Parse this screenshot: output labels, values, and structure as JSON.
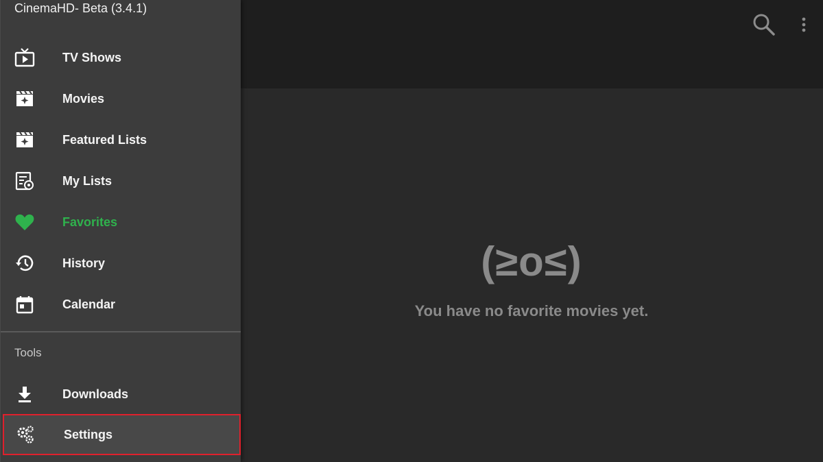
{
  "app": {
    "title": "CinemaHD- Beta (3.4.1)"
  },
  "drawer": {
    "items": [
      {
        "label": "TV Shows",
        "icon": "tv-icon"
      },
      {
        "label": "Movies",
        "icon": "movie-clapper-icon"
      },
      {
        "label": "Featured Lists",
        "icon": "movie-clapper-icon"
      },
      {
        "label": "My Lists",
        "icon": "list-settings-icon"
      },
      {
        "label": "Favorites",
        "icon": "heart-icon",
        "active": true
      },
      {
        "label": "History",
        "icon": "history-icon"
      },
      {
        "label": "Calendar",
        "icon": "calendar-icon"
      }
    ],
    "tools_label": "Tools",
    "tools": [
      {
        "label": "Downloads",
        "icon": "download-icon"
      },
      {
        "label": "Settings",
        "icon": "gears-icon",
        "focused": true
      }
    ]
  },
  "toolbar": {
    "search_icon": "search-icon",
    "more_icon": "more-vert-icon"
  },
  "empty_state": {
    "emoticon": "(≥o≤)",
    "message": "You have no favorite movies yet."
  },
  "colors": {
    "accent": "#2fb24d",
    "focus_border": "#e0202c",
    "drawer_bg": "#3c3c3c",
    "topbar_bg": "#1e1e1e",
    "content_bg": "#292929"
  }
}
